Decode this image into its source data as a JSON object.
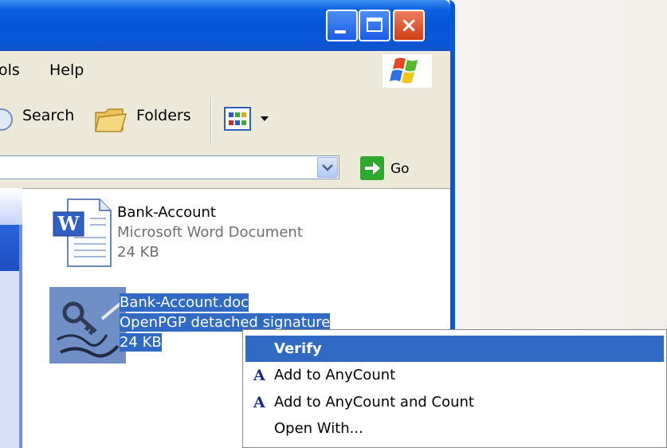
{
  "menubar": {
    "items": [
      "ols",
      "Help"
    ]
  },
  "toolbar": {
    "search_label": "Search",
    "folders_label": "Folders"
  },
  "addressbar": {
    "value": "",
    "go_label": "Go"
  },
  "files": [
    {
      "name": "Bank-Account",
      "type": "Microsoft Word Document",
      "size": "24 KB",
      "icon": "word-document-icon",
      "selected": false
    },
    {
      "name": "Bank-Account.doc",
      "type": "OpenPGP detached signature",
      "size": "24 KB",
      "icon": "pgp-signature-icon",
      "selected": true
    }
  ],
  "context_menu": {
    "items": [
      {
        "label": "Verify",
        "highlighted": true,
        "bold": true,
        "icon": null
      },
      {
        "label": "Add to AnyCount",
        "highlighted": false,
        "bold": false,
        "icon": "anycount-icon"
      },
      {
        "label": "Add to AnyCount and Count",
        "highlighted": false,
        "bold": false,
        "icon": "anycount-icon"
      },
      {
        "label": "Open With...",
        "highlighted": false,
        "bold": false,
        "icon": null
      }
    ]
  },
  "colors": {
    "titlebar": "#0854d4",
    "selection": "#316ac5",
    "chrome": "#ece9d8",
    "close": "#d23d14"
  }
}
